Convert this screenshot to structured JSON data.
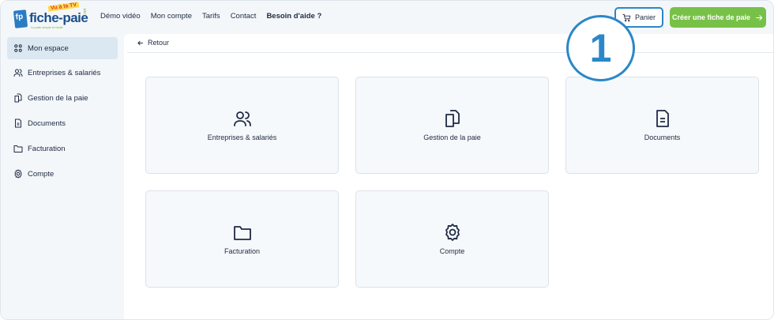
{
  "header": {
    "logo": {
      "mark": "fp",
      "brand": "fiche-paie",
      "badge": "Vu à la TV",
      "suffix": ".net",
      "tagline": "La paie simple et facile"
    },
    "nav": [
      {
        "label": "Démo vidéo",
        "bold": false
      },
      {
        "label": "Mon compte",
        "bold": false
      },
      {
        "label": "Tarifs",
        "bold": false
      },
      {
        "label": "Contact",
        "bold": false
      },
      {
        "label": "Besoin d'aide ?",
        "bold": true
      }
    ],
    "cart_label": "Panier",
    "cta_label": "Créer une fiche de paie",
    "callout_number": "1"
  },
  "sidebar": {
    "items": [
      {
        "label": "Mon espace",
        "icon": "grid-icon",
        "active": true
      },
      {
        "label": "Entreprises & salariés",
        "icon": "users-icon",
        "active": false
      },
      {
        "label": "Gestion de la paie",
        "icon": "documents-icon",
        "active": false
      },
      {
        "label": "Documents",
        "icon": "file-icon",
        "active": false
      },
      {
        "label": "Facturation",
        "icon": "folder-icon",
        "active": false
      },
      {
        "label": "Compte",
        "icon": "gear-icon",
        "active": false
      }
    ]
  },
  "main": {
    "back_label": "Retour",
    "cards": [
      {
        "label": "Entreprises & salariés",
        "icon": "users-icon"
      },
      {
        "label": "Gestion de la paie",
        "icon": "documents-icon"
      },
      {
        "label": "Documents",
        "icon": "file-icon"
      },
      {
        "label": "Facturation",
        "icon": "folder-icon"
      },
      {
        "label": "Compte",
        "icon": "gear-icon"
      }
    ]
  },
  "colors": {
    "accent_blue": "#2b87c8",
    "cta_green": "#78c148",
    "brand_blue": "#1d4f8a",
    "text": "#1f2a44",
    "active_bg": "#dbe7f1"
  }
}
